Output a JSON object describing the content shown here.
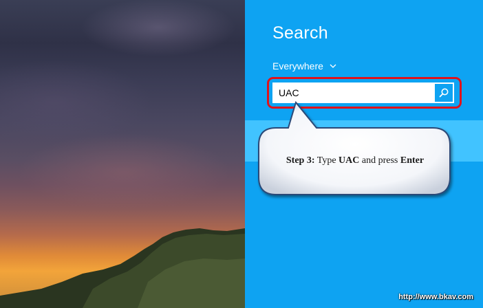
{
  "charm": {
    "title": "Search",
    "scope_label": "Everywhere",
    "search_value": "UAC",
    "search_icon": "search-icon",
    "scope_icon": "chevron-down-icon"
  },
  "callout": {
    "step_label": "Step 3:",
    "text_type": "Type",
    "keyword": "UAC",
    "text_and_press": "and press",
    "key": "Enter"
  },
  "watermark": "http://www.bkav.com",
  "colors": {
    "charm_bg": "#0ea3f2",
    "result_band": "#41c3ff",
    "highlight": "#e0121b",
    "callout_border": "#2b4a78"
  }
}
